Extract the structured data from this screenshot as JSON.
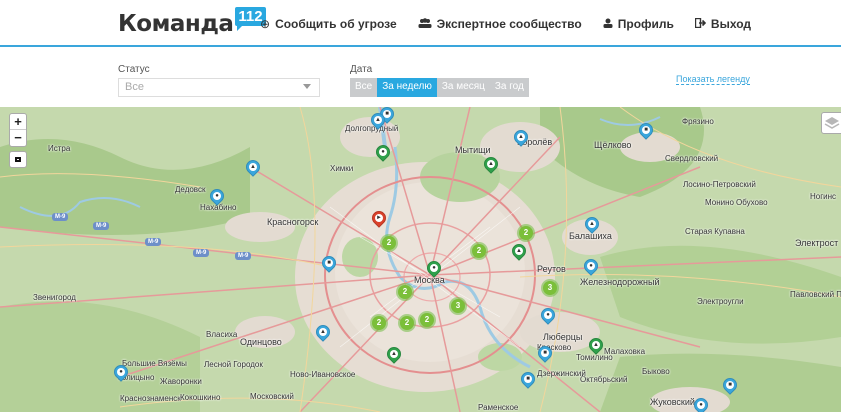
{
  "header": {
    "logo_text": "Команда",
    "logo_badge": "112",
    "nav": [
      {
        "icon": "plus-circle-icon",
        "glyph": "⊕",
        "label": "Сообщить об угрозе"
      },
      {
        "icon": "users-icon",
        "glyph": "👥",
        "label": "Экспертное сообщество"
      },
      {
        "icon": "user-icon",
        "glyph": "👤",
        "label": "Профиль"
      },
      {
        "icon": "sign-out-icon",
        "glyph": "⇥",
        "label": "Выход"
      }
    ]
  },
  "filters": {
    "status_label": "Статус",
    "status_value": "Все",
    "date_label": "Дата",
    "date_options": [
      "Все",
      "За неделю",
      "За месяц",
      "За год"
    ],
    "date_selected": "За неделю",
    "legend_link": "Показать легенду"
  },
  "map": {
    "labels": {
      "dolgoprudny": "Долгопрудный",
      "himki": "Химки",
      "mytishchi": "Мытищи",
      "korolev": "Королёв",
      "shchelkovo": "Щёлково",
      "krasnogorsk": "Красногорск",
      "balashikha": "Балашиха",
      "moskva": "Москва",
      "reutov": "Реутов",
      "zheleznodorozhny": "Железнодорожный",
      "odintsovo": "Одинцово",
      "lyubertsy": "Люберцы",
      "zhukovsky": "Жуковский",
      "elektrostal": "Электрост",
      "nogins": "Ногинс",
      "istra": "Истра",
      "dedovsk": "Дедовск",
      "nahabino": "Нахабино",
      "zvenigorod": "Звенигород",
      "golitsyno": "Голицыно",
      "krasnoznamensk": "Краснознаменск",
      "tomilino": "Томилино",
      "oktyabrsky": "Октябрьский",
      "sverdlovsky": "Свердловский",
      "fryazino": "Фрязино",
      "monino": "Монино",
      "obukhovo": "Обухово",
      "losino_petrovsky": "Лосино-Петровский",
      "staraya_kupavna": "Старая Купавна",
      "elektrougli": "Электроугли",
      "vlasikha": "Власиха",
      "lesnoy_gorodok": "Лесной Городок",
      "kokoshkino": "Кокошкино",
      "moskovsky": "Московский",
      "bykovo": "Быково",
      "ramenskoe": "Раменское",
      "kraskovo": "Красково",
      "dzerzhinsky": "Дзержинский",
      "malakhovka": "Малаховка",
      "bolshie_vyazemy": "Большие Вязёмы",
      "novo_ivanovskoe": "Ново-Ивановское",
      "pavlovsky_posad": "Павловский Посад",
      "zhavoronki": "Жаворонки"
    },
    "shields": [
      "М-9",
      "М-9",
      "М-9",
      "М-9",
      "М-9"
    ],
    "clusters": [
      {
        "count": "2"
      },
      {
        "count": "2"
      },
      {
        "count": "2"
      },
      {
        "count": "2"
      },
      {
        "count": "3"
      },
      {
        "count": "2"
      },
      {
        "count": "3"
      },
      {
        "count": "2"
      },
      {
        "count": "2"
      }
    ]
  },
  "controls": {
    "zoom_in": "+",
    "zoom_out": "−"
  }
}
